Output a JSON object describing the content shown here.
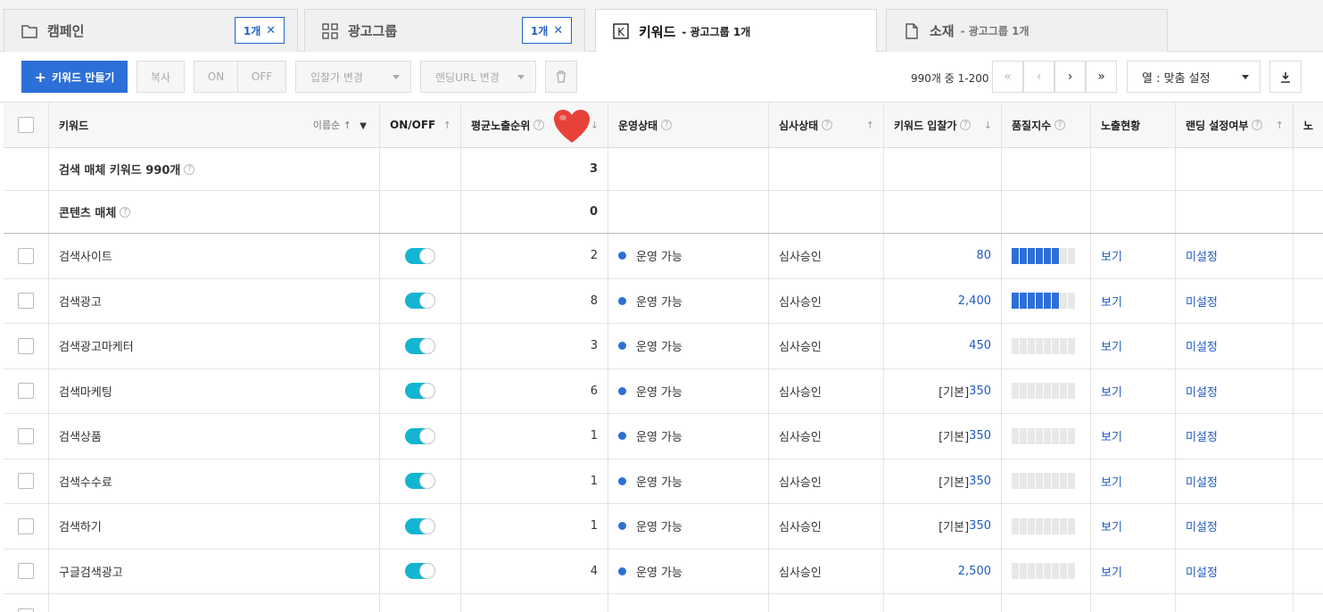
{
  "tabs": [
    {
      "label": "캠페인",
      "badge": "1개"
    },
    {
      "label": "광고그룹",
      "badge": "1개"
    },
    {
      "label": "키워드",
      "sub": "- 광고그룹 1개"
    },
    {
      "label": "소재",
      "sub": "- 광고그룹 1개"
    }
  ],
  "toolbar": {
    "create": "키워드 만들기",
    "copy": "복사",
    "on": "ON",
    "off": "OFF",
    "bid_change": "입찰가 변경",
    "landing_change": "랜딩URL 변경",
    "count": "990개 중 1-200",
    "columns": "열 : 맞춤 설정"
  },
  "header": {
    "keyword": "키워드",
    "sort_label": "이름순",
    "onoff": "ON/OFF",
    "avg_rank": "평균노출순위",
    "status": "운영상태",
    "review": "심사상태",
    "bid": "키워드 입찰가",
    "quality": "품질지수",
    "exposure": "노출현황",
    "landing": "랜딩 설정여부",
    "extra": "노"
  },
  "summary": [
    {
      "label": "검색 매체 키워드 990개",
      "rank": "3"
    },
    {
      "label": "콘텐츠 매체",
      "rank": "0"
    }
  ],
  "rows": [
    {
      "keyword": "검색사이트",
      "rank": "2",
      "status": "운영 가능",
      "review": "심사승인",
      "bid_prefix": "",
      "bid": "80",
      "quality": 0.6,
      "exposure": "보기",
      "landing": "미설정"
    },
    {
      "keyword": "검색광고",
      "rank": "8",
      "status": "운영 가능",
      "review": "심사승인",
      "bid_prefix": "",
      "bid": "2,400",
      "quality": 0.6,
      "exposure": "보기",
      "landing": "미설정"
    },
    {
      "keyword": "검색광고마케터",
      "rank": "3",
      "status": "운영 가능",
      "review": "심사승인",
      "bid_prefix": "",
      "bid": "450",
      "quality": 0,
      "exposure": "보기",
      "landing": "미설정"
    },
    {
      "keyword": "검색마케팅",
      "rank": "6",
      "status": "운영 가능",
      "review": "심사승인",
      "bid_prefix": "[기본]",
      "bid": "350",
      "quality": 0,
      "exposure": "보기",
      "landing": "미설정"
    },
    {
      "keyword": "검색상품",
      "rank": "1",
      "status": "운영 가능",
      "review": "심사승인",
      "bid_prefix": "[기본]",
      "bid": "350",
      "quality": 0,
      "exposure": "보기",
      "landing": "미설정"
    },
    {
      "keyword": "검색수수료",
      "rank": "1",
      "status": "운영 가능",
      "review": "심사승인",
      "bid_prefix": "[기본]",
      "bid": "350",
      "quality": 0,
      "exposure": "보기",
      "landing": "미설정"
    },
    {
      "keyword": "검색하기",
      "rank": "1",
      "status": "운영 가능",
      "review": "심사승인",
      "bid_prefix": "[기본]",
      "bid": "350",
      "quality": 0,
      "exposure": "보기",
      "landing": "미설정"
    },
    {
      "keyword": "구글검색광고",
      "rank": "4",
      "status": "운영 가능",
      "review": "심사승인",
      "bid_prefix": "",
      "bid": "2,500",
      "quality": 0,
      "exposure": "보기",
      "landing": "미설정"
    }
  ],
  "colors": {
    "primary": "#2d6fd8",
    "toggle": "#13b5d1",
    "link": "#1f5bc2"
  }
}
